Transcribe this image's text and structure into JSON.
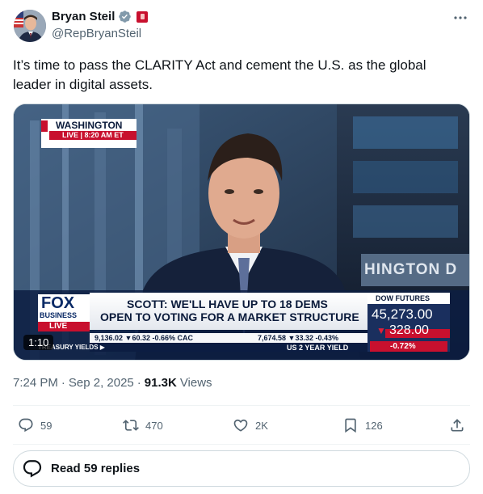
{
  "author": {
    "display_name": "Bryan Steil",
    "handle": "@RepBryanSteil"
  },
  "tweet": {
    "text": "It’s time to pass the CLARITY Act and cement the U.S. as the global leader in digital assets."
  },
  "video": {
    "duration": "1:10",
    "location_bug": "WASHINGTON",
    "live_time": "LIVE | 8:20 AM ET",
    "backdrop_text": "HINGTON D",
    "network_top": "FOX",
    "network_mid": "BUSINESS",
    "network_live": "LIVE",
    "headline_line1": "SCOTT: WE'LL HAVE UP TO 18 DEMS",
    "headline_line2": "OPEN TO VOTING FOR A MARKET STRUCTURE",
    "ticker_left": "9,136.02 ▼60.32 -0.66% CAC",
    "ticker_left_sub": "TREASURY YIELDS ▶",
    "ticker_right": "7,674.58 ▼33.32 -0.43%",
    "ticker_right_sub": "US 2 YEAR YIELD",
    "dow_label": "DOW FUTURES",
    "dow_value": "45,273.00",
    "dow_change": "328.00",
    "dow_pct": "-0.72%"
  },
  "meta": {
    "time": "7:24 PM",
    "separator": "·",
    "date": "Sep 2, 2025",
    "views_count": "91.3K",
    "views_label": "Views"
  },
  "actions": {
    "replies": "59",
    "reposts": "470",
    "likes": "2K",
    "bookmarks": "126"
  },
  "read_replies_label": "Read 59 replies",
  "colors": {
    "text_primary": "#0f1419",
    "text_secondary": "#536471",
    "verified_blue": "#1d9bf0",
    "fox_red": "#c8102e",
    "fox_blue": "#0a2a66"
  }
}
